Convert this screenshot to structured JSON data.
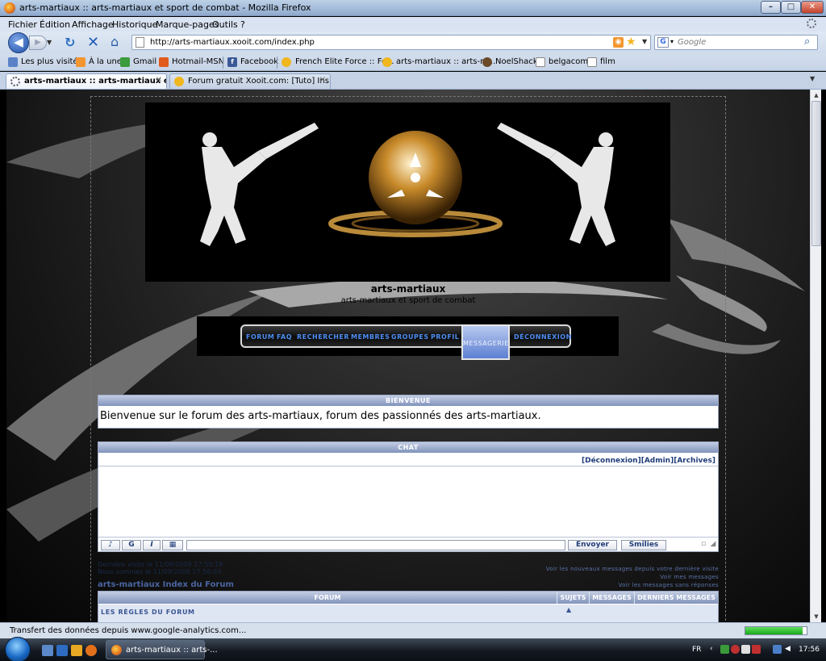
{
  "window": {
    "title": "arts-martiaux :: arts-martiaux et sport de combat - Mozilla Firefox",
    "min": "–",
    "max": "□",
    "close": "✕"
  },
  "menu": [
    "Fichier",
    "Édition",
    "Affichage",
    "Historique",
    "Marque-pages",
    "Outils",
    "?"
  ],
  "nav": {
    "url": "http://arts-martiaux.xooit.com/index.php",
    "search_placeholder": "Google",
    "back_glyph": "◀",
    "reload_glyph": "↻",
    "stop_glyph": "✕",
    "home_glyph": "⌂"
  },
  "bookmarks": [
    "Les plus visités",
    "À la une",
    "Gmail",
    "Hotmail-MSN",
    "Facebook",
    "French Elite Force :: Fo...",
    "arts-martiaux :: arts-m...",
    "NoelShack",
    "belgacom",
    "film"
  ],
  "tabs": [
    {
      "label": "arts-martiaux :: arts-martiaux et s..."
    },
    {
      "label": "Forum gratuit Xooit.com: [Tuto] Ins..."
    }
  ],
  "site": {
    "title": "arts-martiaux",
    "description": "arts-martiaux et sport de combat",
    "nav_items": [
      "FORUM",
      "FAQ",
      "RECHERCHER",
      "MEMBRES",
      "GROUPES",
      "PROFIL",
      "MESSAGERIE",
      "DÉCONNEXION"
    ],
    "welcome": {
      "header": "BIENVENUE",
      "message": "Bienvenue sur le forum des arts-martiaux, forum des passionnés des arts-martiaux."
    },
    "chat": {
      "header": "CHAT",
      "links": "[Déconnexion][Admin][Archives]",
      "btn_g": "G",
      "btn_i": "I",
      "send": "Envoyer",
      "smilies": "Smilies"
    },
    "stats": [
      "Dernière visite le 11/09/2009 17:55:18",
      "Nous sommes le 11/09/2009 17:56:03"
    ],
    "index_title": "arts-martiaux Index du Forum",
    "right_links": [
      "Voir les nouveaux messages depuis votre dernière visite",
      "Voir mes messages",
      "Voir les messages sans réponses"
    ],
    "table": {
      "headers": [
        "FORUM",
        "SUJETS",
        "MESSAGES",
        "DERNIERS MESSAGES"
      ],
      "first_category": "LES RÈGLES DU FORUM"
    }
  },
  "status": {
    "text": "Transfert des données depuis www.google-analytics.com...",
    "progress": 0.93
  },
  "taskbar": {
    "window_label": "arts-martiaux :: arts-...",
    "lang": "FR",
    "time": "17:56"
  },
  "colors": {
    "nav_link": "#4d8cf0",
    "panel_header": "#8294bc",
    "link": "#1f3c7a"
  }
}
